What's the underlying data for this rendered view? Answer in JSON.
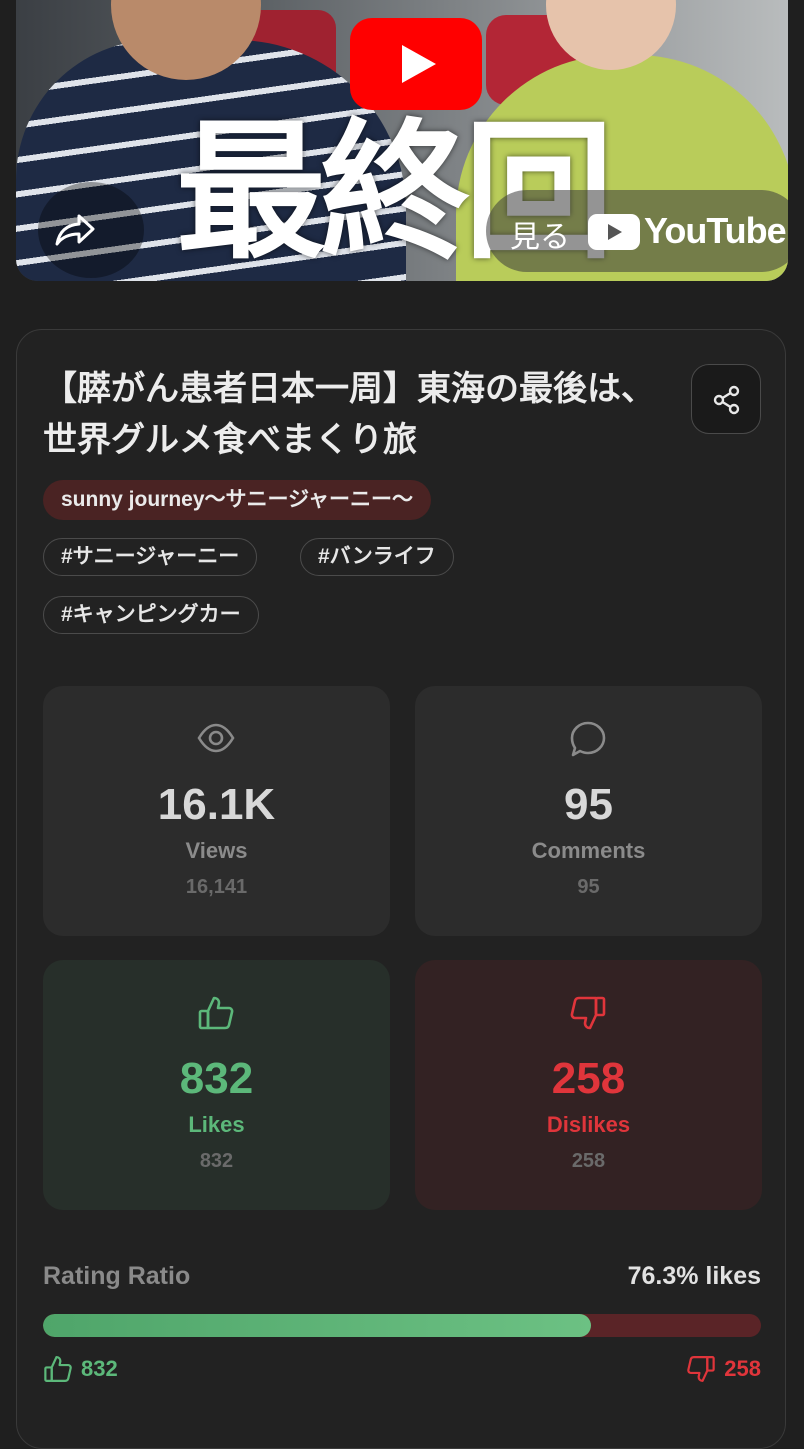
{
  "thumbnail": {
    "overlay_text": "最終回",
    "watch_label": "見る",
    "youtube_word": "YouTube"
  },
  "video": {
    "title": "【膵がん患者日本一周】東海の最後は、世界グルメ食べまくり旅",
    "channel": "sunny journey〜サニージャーニー〜",
    "tags": [
      "#サニージャーニー",
      "#バンライフ",
      "#キャンピングカー"
    ]
  },
  "stats": {
    "views": {
      "big": "16.1K",
      "label": "Views",
      "exact": "16,141"
    },
    "comments": {
      "big": "95",
      "label": "Comments",
      "exact": "95"
    },
    "likes": {
      "big": "832",
      "label": "Likes",
      "exact": "832"
    },
    "dislikes": {
      "big": "258",
      "label": "Dislikes",
      "exact": "258"
    }
  },
  "rating": {
    "label": "Rating Ratio",
    "value_text": "76.3% likes",
    "like_fraction": 0.763,
    "likes": "832",
    "dislikes": "258"
  },
  "colors": {
    "like": "#5cb87a",
    "dislike": "#e0353b",
    "youtube_red": "#ff0000"
  }
}
